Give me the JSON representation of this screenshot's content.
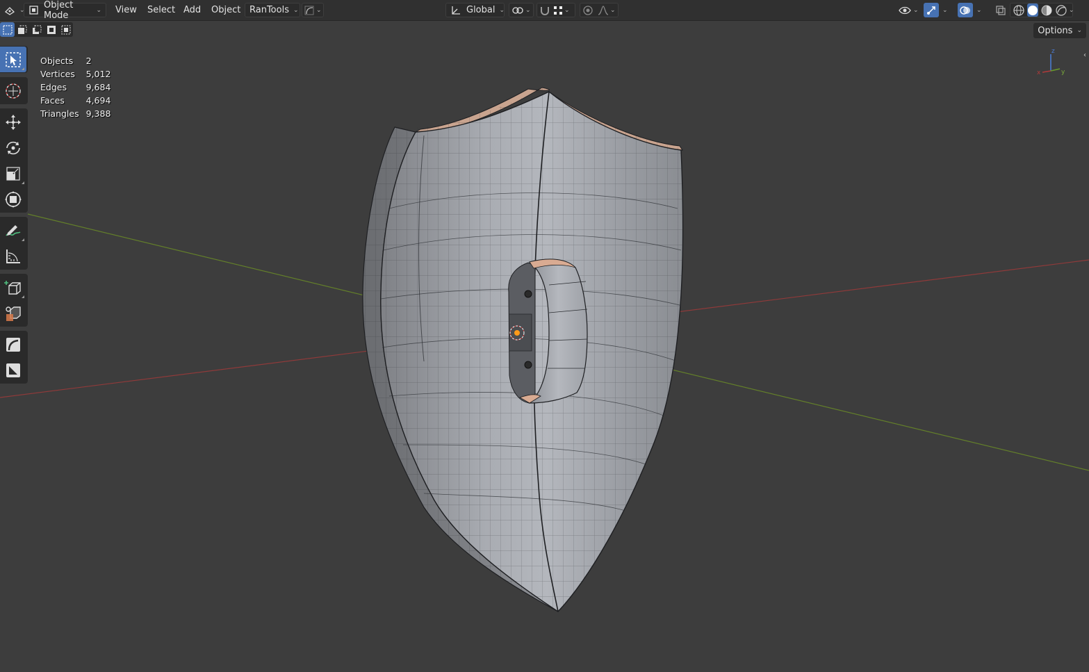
{
  "header": {
    "mode_label": "Object Mode",
    "menus": [
      "View",
      "Select",
      "Add",
      "Object"
    ],
    "addon_label": "RanTools",
    "orientation_label": "Global"
  },
  "subbar": {
    "options_label": "Options"
  },
  "stats": [
    {
      "label": "Objects",
      "value": "2"
    },
    {
      "label": "Vertices",
      "value": "5,012"
    },
    {
      "label": "Edges",
      "value": "9,684"
    },
    {
      "label": "Faces",
      "value": "4,694"
    },
    {
      "label": "Triangles",
      "value": "9,388"
    }
  ],
  "gizmo": {
    "x_label": "x",
    "y_label": "y",
    "z_label": "z"
  },
  "colors": {
    "accent": "#4772b3",
    "header_bg": "#303030",
    "viewport_bg": "#3d3d3d",
    "x_axis": "#9a3a3a",
    "y_axis": "#6a8a2a",
    "z_axis": "#4a7ad0"
  },
  "tools": [
    {
      "name": "select-box-icon"
    },
    {
      "name": "cursor-icon"
    },
    {
      "name": "move-icon"
    },
    {
      "name": "rotate-icon"
    },
    {
      "name": "scale-icon"
    },
    {
      "name": "transform-icon"
    },
    {
      "name": "annotate-icon"
    },
    {
      "name": "measure-icon"
    },
    {
      "name": "add-cube-icon"
    },
    {
      "name": "add-object-icon"
    },
    {
      "name": "curve-tool-icon"
    },
    {
      "name": "image-tool-icon"
    }
  ]
}
